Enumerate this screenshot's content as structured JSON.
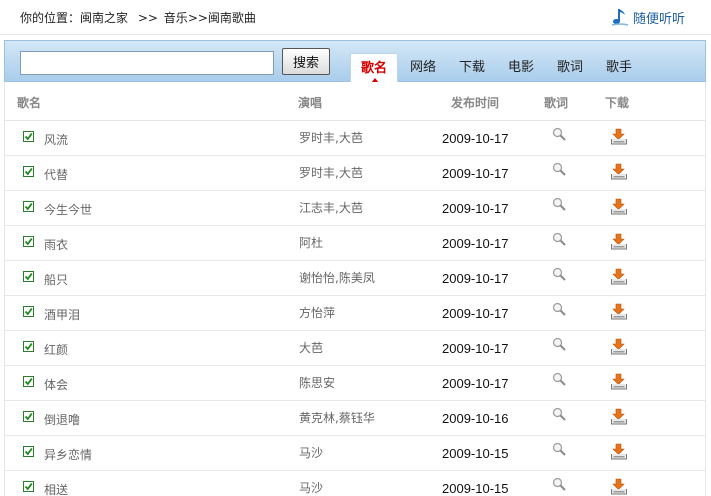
{
  "breadcrumb": {
    "prefix": "你的位置：",
    "home": "闽南之家",
    "sep1": ">>",
    "section": "音乐",
    "sep2": ">>",
    "current": "闽南歌曲"
  },
  "listen_random": {
    "label": "随便听听",
    "icon": "music-note-icon"
  },
  "search": {
    "value": "",
    "placeholder": "",
    "button_label": "搜索"
  },
  "tabs": [
    {
      "label": "歌名",
      "active": true
    },
    {
      "label": "网络",
      "active": false
    },
    {
      "label": "下载",
      "active": false
    },
    {
      "label": "电影",
      "active": false
    },
    {
      "label": "歌词",
      "active": false
    },
    {
      "label": "歌手",
      "active": false
    }
  ],
  "table": {
    "headers": {
      "song": "歌名",
      "artist": "演唱",
      "date": "发布时间",
      "lyrics": "歌词",
      "download": "下载"
    },
    "rows": [
      {
        "song": "风流",
        "artist": "罗时丰,大芭",
        "date": "2009-10-17",
        "checked": true
      },
      {
        "song": "代替",
        "artist": "罗时丰,大芭",
        "date": "2009-10-17",
        "checked": true
      },
      {
        "song": "今生今世",
        "artist": "江志丰,大芭",
        "date": "2009-10-17",
        "checked": true
      },
      {
        "song": "雨衣",
        "artist": "阿杜",
        "date": "2009-10-17",
        "checked": true
      },
      {
        "song": "船只",
        "artist": "谢怡怡,陈美凤",
        "date": "2009-10-17",
        "checked": true
      },
      {
        "song": "酒甲泪",
        "artist": "方怡萍",
        "date": "2009-10-17",
        "checked": true
      },
      {
        "song": "红颜",
        "artist": "大芭",
        "date": "2009-10-17",
        "checked": true
      },
      {
        "song": "体会",
        "artist": "陈思安",
        "date": "2009-10-17",
        "checked": true
      },
      {
        "song": "倒退噜",
        "artist": "黄克林,蔡钰华",
        "date": "2009-10-16",
        "checked": true
      },
      {
        "song": "异乡恋情",
        "artist": "马沙",
        "date": "2009-10-15",
        "checked": true
      },
      {
        "song": "相送",
        "artist": "马沙",
        "date": "2009-10-15",
        "checked": true
      }
    ]
  },
  "colors": {
    "accent_red": "#d40000",
    "link_blue": "#1f5f9e",
    "band_top": "#d4e7f7",
    "band_bottom": "#a9cdeb"
  }
}
